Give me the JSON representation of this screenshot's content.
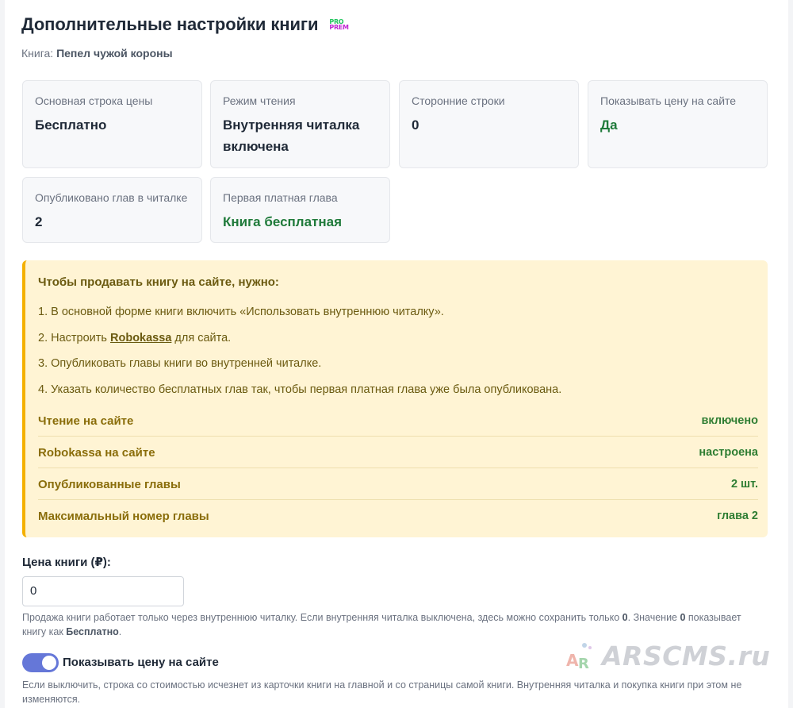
{
  "header": {
    "title": "Дополнительные настройки книги",
    "badge_top": "PRO",
    "badge_bottom": "PREM",
    "book_prefix": "Книга:",
    "book_name": "Пепел чужой короны"
  },
  "cards": [
    {
      "label": "Основная строка цены",
      "value": "Бесплатно"
    },
    {
      "label": "Режим чтения",
      "value": "Внутренняя читалка включена"
    },
    {
      "label": "Сторонние строки",
      "value": "0"
    },
    {
      "label": "Показывать цену на сайте",
      "value": "Да"
    },
    {
      "label": "Опубликовано глав в читалке",
      "value": "2"
    },
    {
      "label": "Первая платная глава",
      "value": "Книга бесплатная"
    }
  ],
  "notice": {
    "title": "Чтобы продавать книгу на сайте, нужно:",
    "step1": "1. В основной форме книги включить «Использовать внутреннюю читалку».",
    "step2_prefix": "2. Настроить ",
    "step2_link": "Robokassa",
    "step2_suffix": " для сайта.",
    "step3": "3. Опубликовать главы книги во внутренней читалке.",
    "step4": "4. Указать количество бесплатных глав так, чтобы первая платная глава уже была опубликована.",
    "status": [
      {
        "key": "Чтение на сайте",
        "value": "включено"
      },
      {
        "key": "Robokassa на сайте",
        "value": "настроена"
      },
      {
        "key": "Опубликованные главы",
        "value": "2 шт."
      },
      {
        "key": "Максимальный номер главы",
        "value": "глава 2"
      }
    ]
  },
  "price": {
    "label": "Цена книги (₽):",
    "value": "0",
    "hint_a": "Продажа книги работает только через внутреннюю читалку. Если внутренняя читалка выключена, здесь можно сохранить только ",
    "hint_b": "0",
    "hint_c": ". Значение ",
    "hint_d": "0",
    "hint_e": " показывает книгу как ",
    "hint_f": "Бесплатно",
    "hint_g": "."
  },
  "show_price": {
    "label": "Показывать цену на сайте",
    "enabled": true,
    "hint": "Если выключить, строка со стоимостью исчезнет из карточки книги на главной и со страницы самой книги. Внутренняя читалка и покупка книги при этом не изменяются."
  },
  "watermark": {
    "text": "ARSCMS.ru",
    "logo_letters": "AR"
  },
  "colors": {
    "accent_green": "#1f7a3a",
    "notice_bg": "#fff4d4",
    "notice_border": "#f4b000",
    "toggle": "#6577d8"
  }
}
